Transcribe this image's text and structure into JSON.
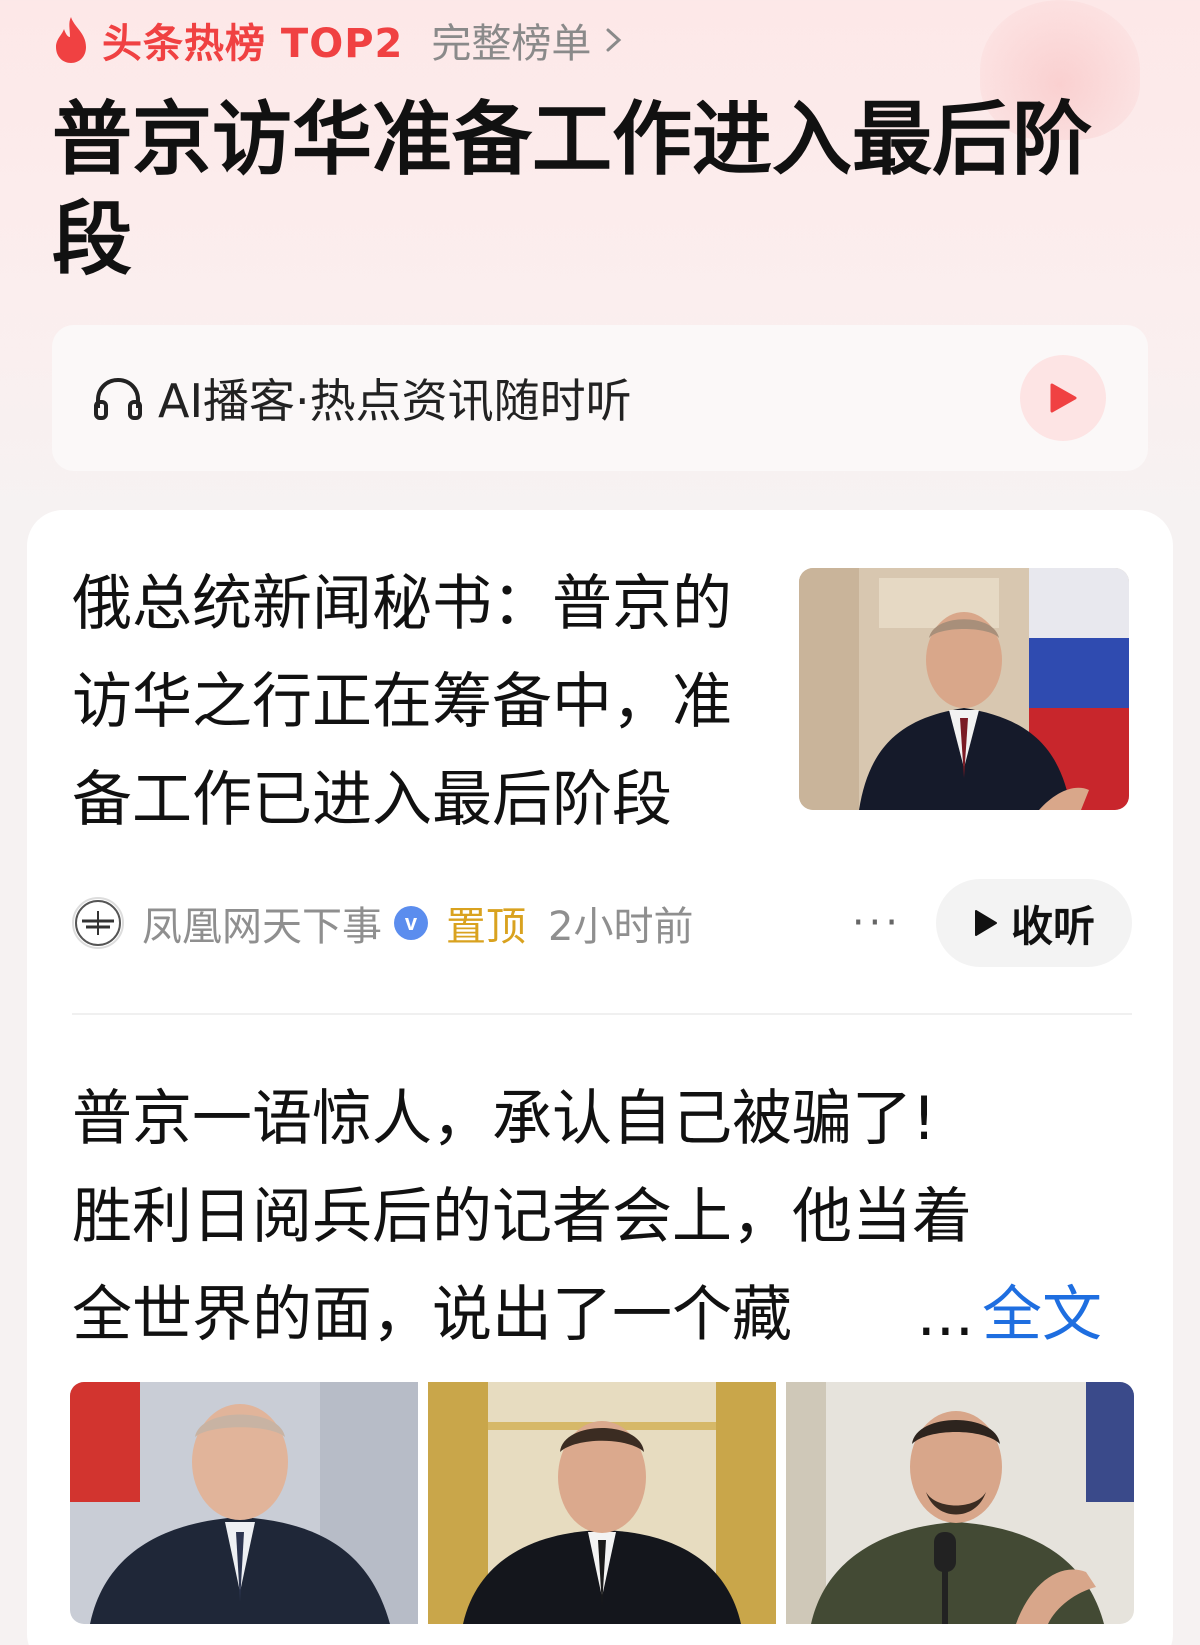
{
  "hot_bar": {
    "label": "头条热榜 TOP2",
    "full_list_label": "完整榜单"
  },
  "headline": "普京访华准备工作进入最后阶段",
  "podcast": {
    "label": "AI播客·热点资讯随时听"
  },
  "news": [
    {
      "title": "俄总统新闻秘书：普京的访华之行正在筹备中，准备工作已进入最后阶段",
      "source": "凤凰网天下事",
      "verified_mark": "v",
      "pinned": "置顶",
      "time": "2小时前",
      "more": "···",
      "listen_label": "收听"
    },
    {
      "lines": [
        "普京一语惊人，承认自己被骗了!",
        "胜利日阅兵后的记者会上，他当着",
        "全世界的面，说出了一个藏"
      ],
      "ellipsis": "...",
      "full_text_label": "全文"
    }
  ],
  "icons": {
    "flame": "flame-icon",
    "chevron": "chevron-right-icon",
    "headphone": "headphone-icon",
    "play": "play-icon",
    "verified": "verified-icon"
  },
  "colors": {
    "accent_red": "#f04142",
    "pinned_gold": "#d9a21f",
    "link_blue": "#1e6ee0"
  }
}
